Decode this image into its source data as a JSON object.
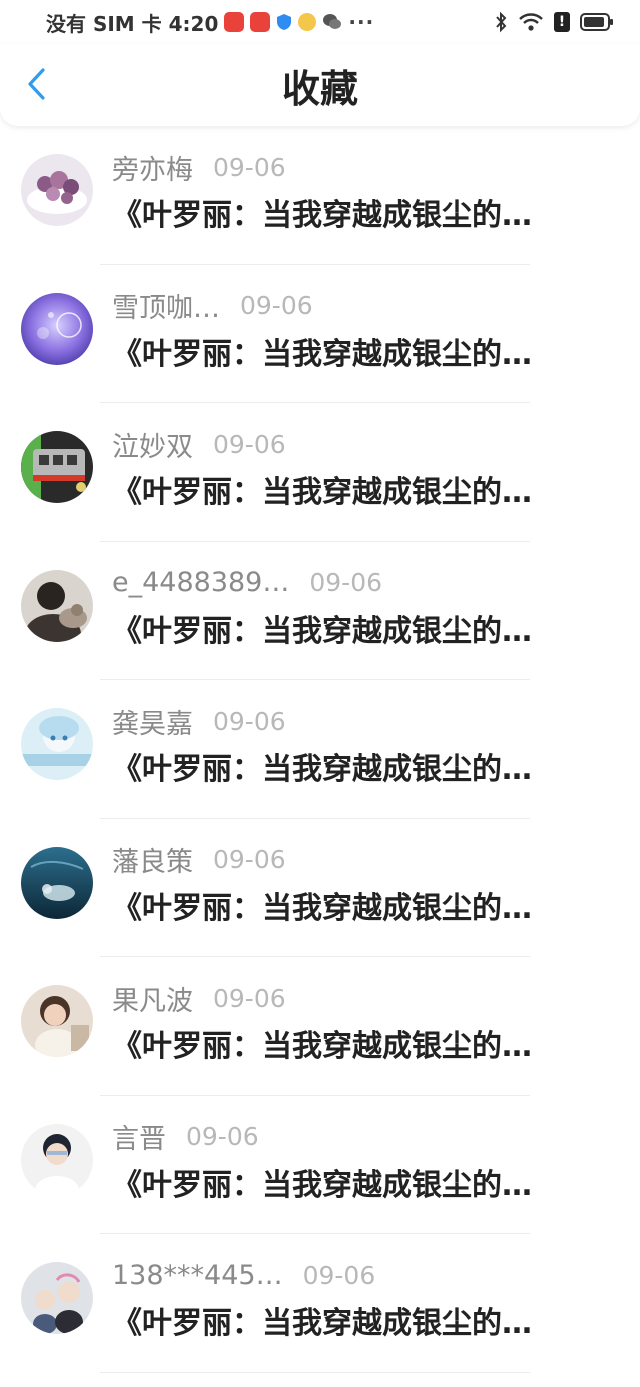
{
  "status_bar": {
    "carrier_time": "没有 SIM 卡 4:20",
    "more": "···",
    "alert_glyph": "!"
  },
  "header": {
    "title": "收藏",
    "back_icon": "chevron-left-icon",
    "accent_color": "#2f9cf0"
  },
  "favorites": [
    {
      "name": "旁亦梅",
      "date": "09-06",
      "preview": "《叶罗丽：当我穿越成银尘的…",
      "avatar": "lavender-food-photo"
    },
    {
      "name": "雪顶咖…",
      "date": "09-06",
      "preview": "《叶罗丽：当我穿越成银尘的…",
      "avatar": "purple-bubbles"
    },
    {
      "name": "泣妙双",
      "date": "09-06",
      "preview": "《叶罗丽：当我穿越成银尘的…",
      "avatar": "train"
    },
    {
      "name": "e_4488389…",
      "date": "09-06",
      "preview": "《叶罗丽：当我穿越成银尘的…",
      "avatar": "person-with-cat"
    },
    {
      "name": "龚昊嘉",
      "date": "09-06",
      "preview": "《叶罗丽：当我穿越成银尘的…",
      "avatar": "anime-girl"
    },
    {
      "name": "藩良策",
      "date": "09-06",
      "preview": "《叶罗丽：当我穿越成银尘的…",
      "avatar": "underwater"
    },
    {
      "name": "果凡波",
      "date": "09-06",
      "preview": "《叶罗丽：当我穿越成银尘的…",
      "avatar": "girl-portrait"
    },
    {
      "name": "言晋",
      "date": "09-06",
      "preview": "《叶罗丽：当我穿越成银尘的…",
      "avatar": "boy-portrait"
    },
    {
      "name": "138***445…",
      "date": "09-06",
      "preview": "《叶罗丽：当我穿越成银尘的…",
      "avatar": "two-people"
    }
  ]
}
